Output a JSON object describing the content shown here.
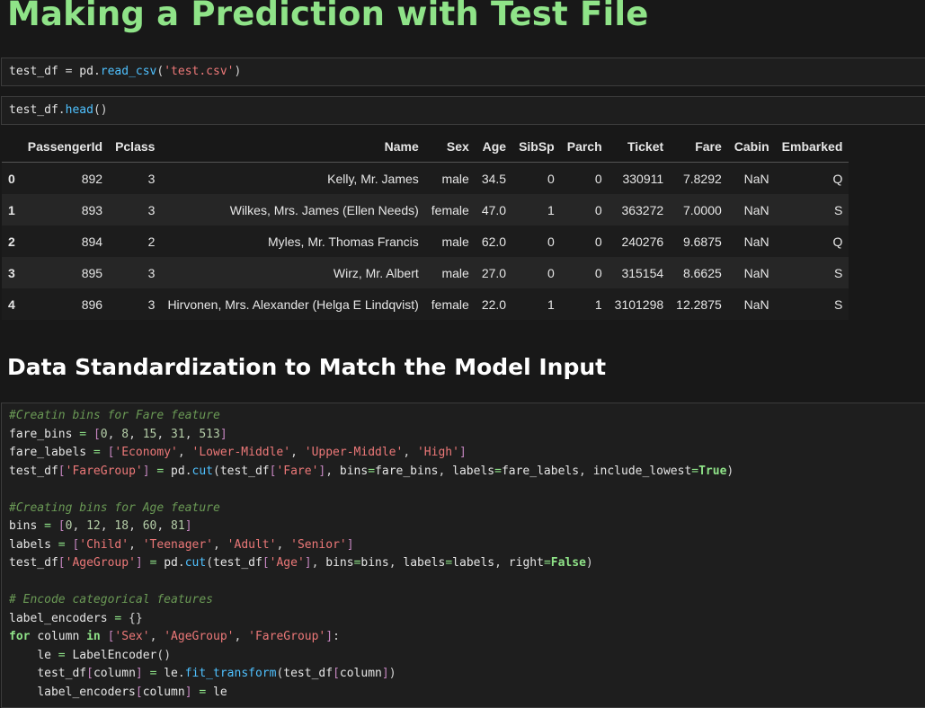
{
  "heading": "Making a Prediction with Test File",
  "cell1": {
    "code": "test_df = pd.read_csv('test.csv')"
  },
  "cell2": {
    "code": "test_df.head()"
  },
  "table": {
    "columns": [
      "",
      "PassengerId",
      "Pclass",
      "Name",
      "Sex",
      "Age",
      "SibSp",
      "Parch",
      "Ticket",
      "Fare",
      "Cabin",
      "Embarked"
    ],
    "rows": [
      [
        "0",
        "892",
        "3",
        "Kelly, Mr. James",
        "male",
        "34.5",
        "0",
        "0",
        "330911",
        "7.8292",
        "NaN",
        "Q"
      ],
      [
        "1",
        "893",
        "3",
        "Wilkes, Mrs. James (Ellen Needs)",
        "female",
        "47.0",
        "1",
        "0",
        "363272",
        "7.0000",
        "NaN",
        "S"
      ],
      [
        "2",
        "894",
        "2",
        "Myles, Mr. Thomas Francis",
        "male",
        "62.0",
        "0",
        "0",
        "240276",
        "9.6875",
        "NaN",
        "Q"
      ],
      [
        "3",
        "895",
        "3",
        "Wirz, Mr. Albert",
        "male",
        "27.0",
        "0",
        "0",
        "315154",
        "8.6625",
        "NaN",
        "S"
      ],
      [
        "4",
        "896",
        "3",
        "Hirvonen, Mrs. Alexander (Helga E Lindqvist)",
        "female",
        "22.0",
        "1",
        "1",
        "3101298",
        "12.2875",
        "NaN",
        "S"
      ]
    ]
  },
  "heading2": "Data Standardization to Match the Model Input",
  "cell3": {
    "lines": [
      "#Creatin bins for Fare feature",
      "fare_bins = [0, 8, 15, 31, 513]",
      "fare_labels = ['Economy', 'Lower-Middle', 'Upper-Middle', 'High']",
      "test_df['FareGroup'] = pd.cut(test_df['Fare'], bins=fare_bins, labels=fare_labels, include_lowest=True)",
      "",
      "#Creating bins for Age feature",
      "bins = [0, 12, 18, 60, 81]",
      "labels = ['Child', 'Teenager', 'Adult', 'Senior']",
      "test_df['AgeGroup'] = pd.cut(test_df['Age'], bins=bins, labels=labels, right=False)",
      "",
      "# Encode categorical features",
      "label_encoders = {}",
      "for column in ['Sex', 'AgeGroup', 'FareGroup']:",
      "    le = LabelEncoder()",
      "    test_df[column] = le.fit_transform(test_df[column])",
      "    label_encoders[column] = le"
    ]
  },
  "colors": {
    "heading": "#8fe388",
    "string": "#ec7878",
    "number": "#b5cea8",
    "function": "#4fc1ff",
    "comment": "#6a9955"
  }
}
